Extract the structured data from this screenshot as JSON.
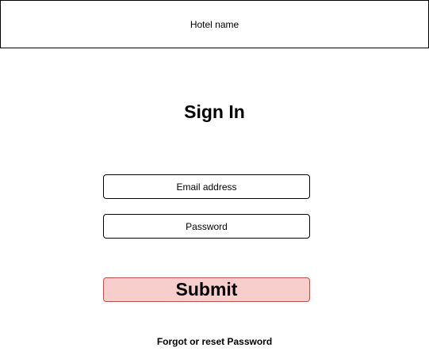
{
  "header": {
    "hotel_name": "Hotel name"
  },
  "main": {
    "title": "Sign In",
    "email": {
      "placeholder": "Email address",
      "value": ""
    },
    "password": {
      "placeholder": "Password",
      "value": ""
    },
    "submit_label": "Submit",
    "forgot_label": "Forgot or reset Password"
  },
  "colors": {
    "submit_fill": "#f8cecc",
    "submit_border": "#b85450"
  }
}
